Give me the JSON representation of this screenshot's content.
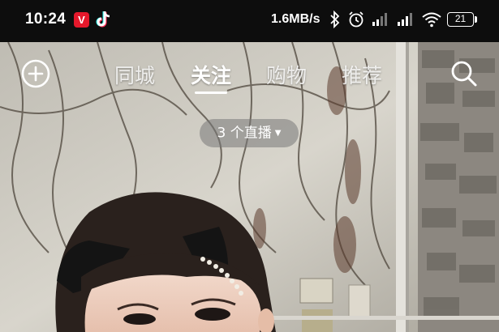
{
  "status_bar": {
    "time": "10:24",
    "app_badge": "V",
    "net_speed": "1.6MB/s",
    "battery": "21",
    "icons": [
      "video-app-icon",
      "tiktok-icon",
      "bluetooth-icon",
      "alarm-icon",
      "signal-icon",
      "signal-icon",
      "wifi-icon",
      "battery-icon"
    ]
  },
  "nav": {
    "tabs": [
      "同城",
      "关注",
      "购物",
      "推荐"
    ],
    "active_tab": "关注",
    "add_icon": "plus-circle-icon",
    "search_icon": "search-icon"
  },
  "live": {
    "label": "3 个直播"
  },
  "colors": {
    "status_bar_bg": "#0d0d0d",
    "app_badge": "#e4182b",
    "tab_active": "#ffffff",
    "tab_inactive": "#d0d0d0"
  }
}
